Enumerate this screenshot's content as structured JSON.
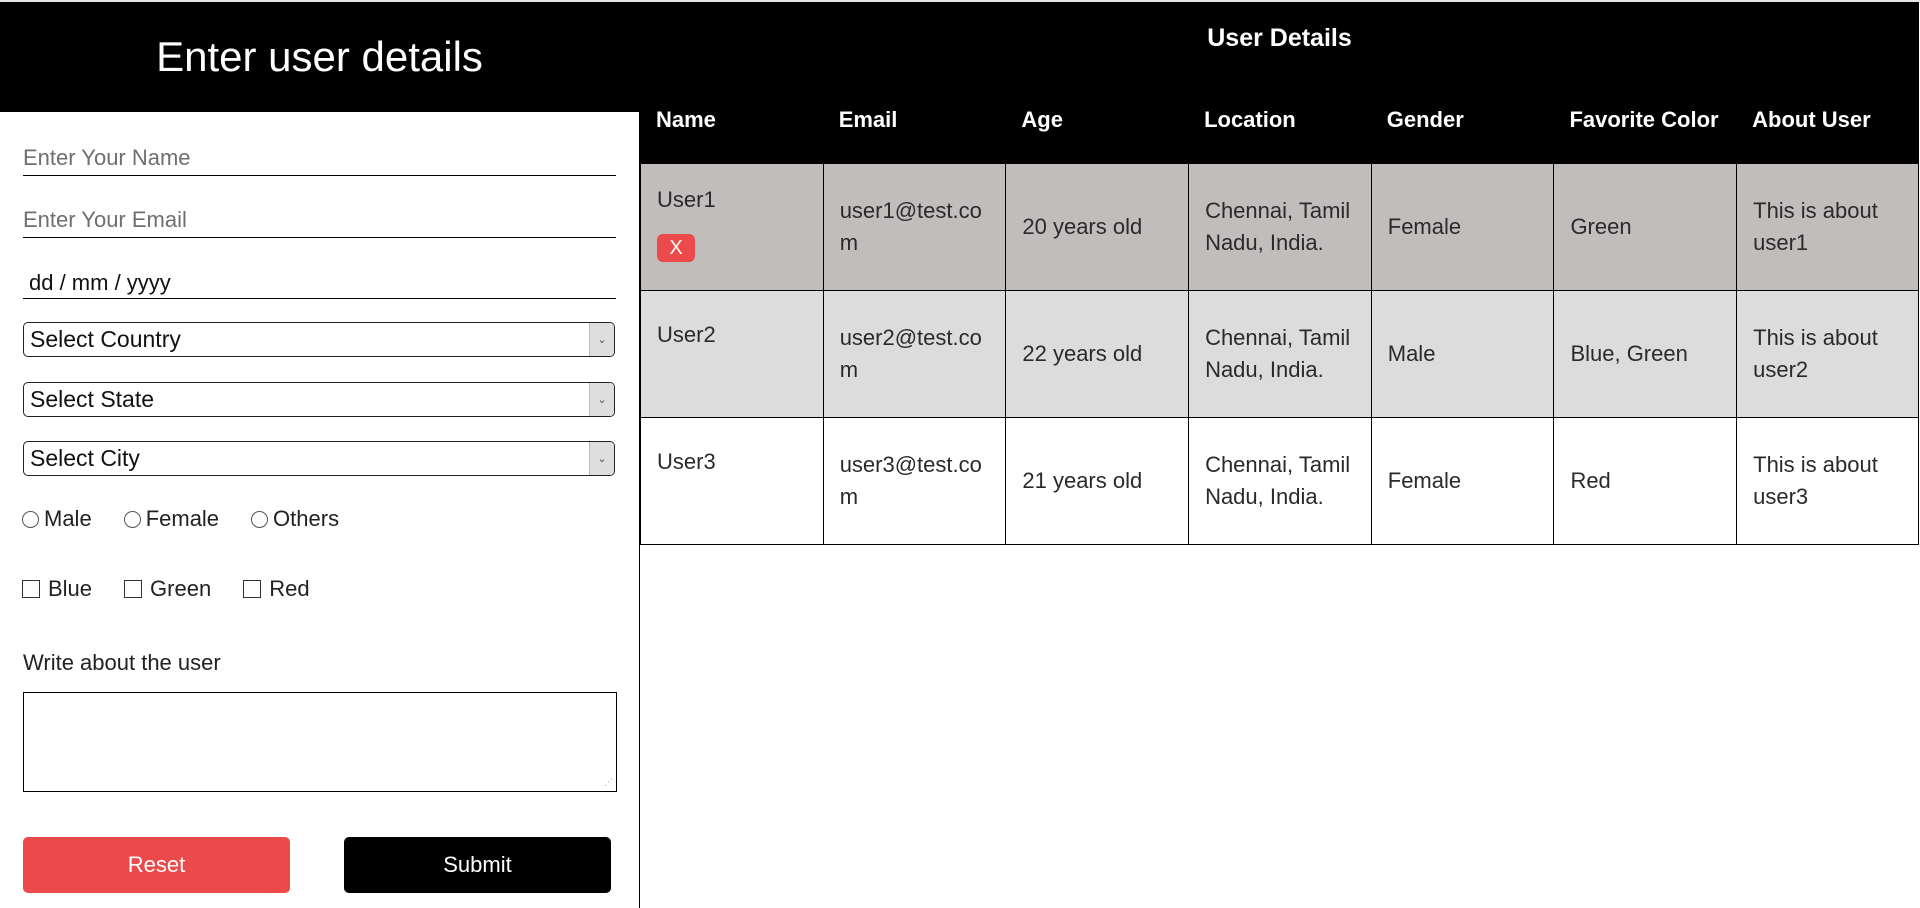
{
  "form": {
    "title": "Enter user details",
    "name_placeholder": "Enter Your Name",
    "email_placeholder": "Enter Your Email",
    "date_placeholder": "dd / mm / yyyy",
    "country_select": "Select Country",
    "state_select": "Select State",
    "city_select": "Select City",
    "gender_options": [
      "Male",
      "Female",
      "Others"
    ],
    "color_options": [
      "Blue",
      "Green",
      "Red"
    ],
    "about_label": "Write about the user",
    "about_value": "",
    "reset_label": "Reset",
    "submit_label": "Submit",
    "colors": {
      "reset": "#ec4a4a",
      "submit": "#000000",
      "header": "#000000"
    }
  },
  "table": {
    "title": "User Details",
    "columns": [
      "Name",
      "Email",
      "Age",
      "Location",
      "Gender",
      "Favorite Color",
      "About User"
    ],
    "delete_label": "X",
    "rows": [
      {
        "name": "User1",
        "email": "user1@test.com",
        "age": "20 years old",
        "location": "Chennai, Tamil Nadu, India.",
        "gender": "Female",
        "color": "Green",
        "about": "This is about user1",
        "show_delete": true
      },
      {
        "name": "User2",
        "email": "user2@test.com",
        "age": "22 years old",
        "location": "Chennai, Tamil Nadu, India.",
        "gender": "Male",
        "color": "Blue, Green",
        "about": "This is about user2",
        "show_delete": false
      },
      {
        "name": "User3",
        "email": "user3@test.com",
        "age": "21 years old",
        "location": "Chennai, Tamil Nadu, India.",
        "gender": "Female",
        "color": "Red",
        "about": "This is about user3",
        "show_delete": false
      }
    ],
    "row_colors": [
      "#c1bdbc",
      "#dcdcdc",
      "#ffffff"
    ]
  }
}
